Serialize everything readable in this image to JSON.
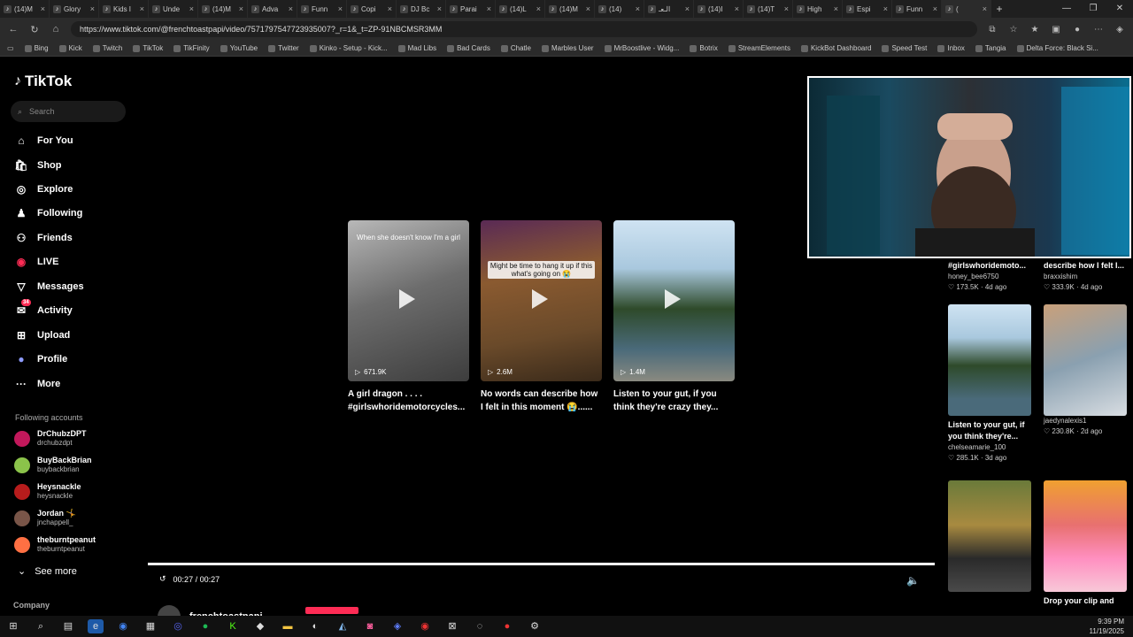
{
  "browser": {
    "tabs": [
      {
        "label": "(14)M",
        "icon": "tiktok-icon"
      },
      {
        "label": "Glory",
        "icon": "tiktok-icon"
      },
      {
        "label": "Kids I",
        "icon": "tiktok-icon"
      },
      {
        "label": "Unde",
        "icon": "tiktok-icon"
      },
      {
        "label": "(14)M",
        "icon": "tiktok-icon"
      },
      {
        "label": "Adva",
        "icon": "tiktok-icon"
      },
      {
        "label": "Funn",
        "icon": "tiktok-icon"
      },
      {
        "label": "Copi",
        "icon": "tiktok-icon"
      },
      {
        "label": "DJ Bc",
        "icon": "tiktok-icon"
      },
      {
        "label": "Parai",
        "icon": "tiktok-icon"
      },
      {
        "label": "(14)L",
        "icon": "tiktok-icon"
      },
      {
        "label": "(14)M",
        "icon": "tiktok-icon"
      },
      {
        "label": "(14)",
        "icon": "tiktok-icon"
      },
      {
        "label": "الـعـ",
        "icon": "tiktok-icon"
      },
      {
        "label": "(14)I",
        "icon": "tiktok-icon"
      },
      {
        "label": "(14)T",
        "icon": "tiktok-icon"
      },
      {
        "label": "High",
        "icon": "tiktok-icon"
      },
      {
        "label": "Espi",
        "icon": "tiktok-icon"
      },
      {
        "label": "Funn",
        "icon": "tiktok-icon"
      },
      {
        "label": "(",
        "icon": "tiktok-icon",
        "active": true
      }
    ],
    "url": "https://www.tiktok.com/@frenchtoastpapi/video/7571797547723935007?_r=1&_t=ZP-91NBCMSR3MM",
    "bookmarks": [
      "Bing",
      "Kick",
      "Twitch",
      "TikTok",
      "TikFinity",
      "YouTube",
      "Twitter",
      "Kinko - Setup - Kick...",
      "Mad Libs",
      "Bad Cards",
      "Chatle",
      "Marbles User",
      "MrBoostlive - Widg...",
      "Botrix",
      "StreamElements",
      "KickBot Dashboard",
      "Speed Test",
      "Inbox",
      "Tangia",
      "Delta Force: Black Si..."
    ]
  },
  "tiktok": {
    "logo": "TikTok",
    "search_placeholder": "Search",
    "nav": [
      {
        "label": "For You",
        "icon": "home-icon"
      },
      {
        "label": "Shop",
        "icon": "shop-icon"
      },
      {
        "label": "Explore",
        "icon": "compass-icon"
      },
      {
        "label": "Following",
        "icon": "following-icon"
      },
      {
        "label": "Friends",
        "icon": "friends-icon"
      },
      {
        "label": "LIVE",
        "icon": "live-icon"
      },
      {
        "label": "Messages",
        "icon": "messages-icon"
      },
      {
        "label": "Activity",
        "icon": "activity-icon",
        "badge": "34"
      },
      {
        "label": "Upload",
        "icon": "upload-icon"
      },
      {
        "label": "Profile",
        "icon": "profile-icon"
      },
      {
        "label": "More",
        "icon": "more-icon"
      }
    ],
    "following_title": "Following accounts",
    "accounts": [
      {
        "name": "DrChubzDPT",
        "handle": "drchubzdpt",
        "color": "#c2185b"
      },
      {
        "name": "BuyBackBrian",
        "handle": "buybackbrian",
        "color": "#8bc34a"
      },
      {
        "name": "Heysnackle",
        "handle": "heysnackle",
        "color": "#b71c1c"
      },
      {
        "name": "Jordan 🤸",
        "handle": "jnchappell_",
        "color": "#795548"
      },
      {
        "name": "theburntpeanut",
        "handle": "theburntpeanut",
        "color": "#ff7043"
      }
    ],
    "see_more": "See more",
    "company": "Company",
    "videos": [
      {
        "views": "671.9K",
        "title": "A girl dragon . . . . #girlswhoridemotorcycles...",
        "caption": "When she doesn't know I'm a girl"
      },
      {
        "views": "2.6M",
        "title": "No words can describe how I felt in this moment 😭......",
        "caption": "Might be time to hang it up if this what's going on 😭"
      },
      {
        "views": "1.4M",
        "title": "Listen to your gut, if you think they're crazy they...",
        "caption": ""
      }
    ],
    "player": {
      "time": "00:27 / 00:27",
      "author": "frenchtoastpapi"
    },
    "right_column": [
      {
        "title": "#girlswhoridemoto...",
        "user": "honey_bee6750",
        "meta": "♡ 173.5K · 4d ago"
      },
      {
        "title": "describe how I felt I...",
        "user": "braxxishim",
        "meta": "♡ 333.9K · 4d ago"
      },
      {
        "title": "Listen to your gut, if you think they're...",
        "user": "chelseamarie_100",
        "meta": "♡ 285.1K · 3d ago"
      },
      {
        "title": "",
        "user": "jaedynalexis1",
        "meta": "♡ 230.8K · 2d ago"
      },
      {
        "title": "",
        "user": "",
        "meta": ""
      },
      {
        "title": "Drop your clip and",
        "user": "",
        "meta": ""
      }
    ]
  },
  "taskbar": {
    "time": "9:39 PM",
    "date": "11/19/2025"
  },
  "colors": {
    "accent": "#fe2c55",
    "bg": "#000000"
  }
}
